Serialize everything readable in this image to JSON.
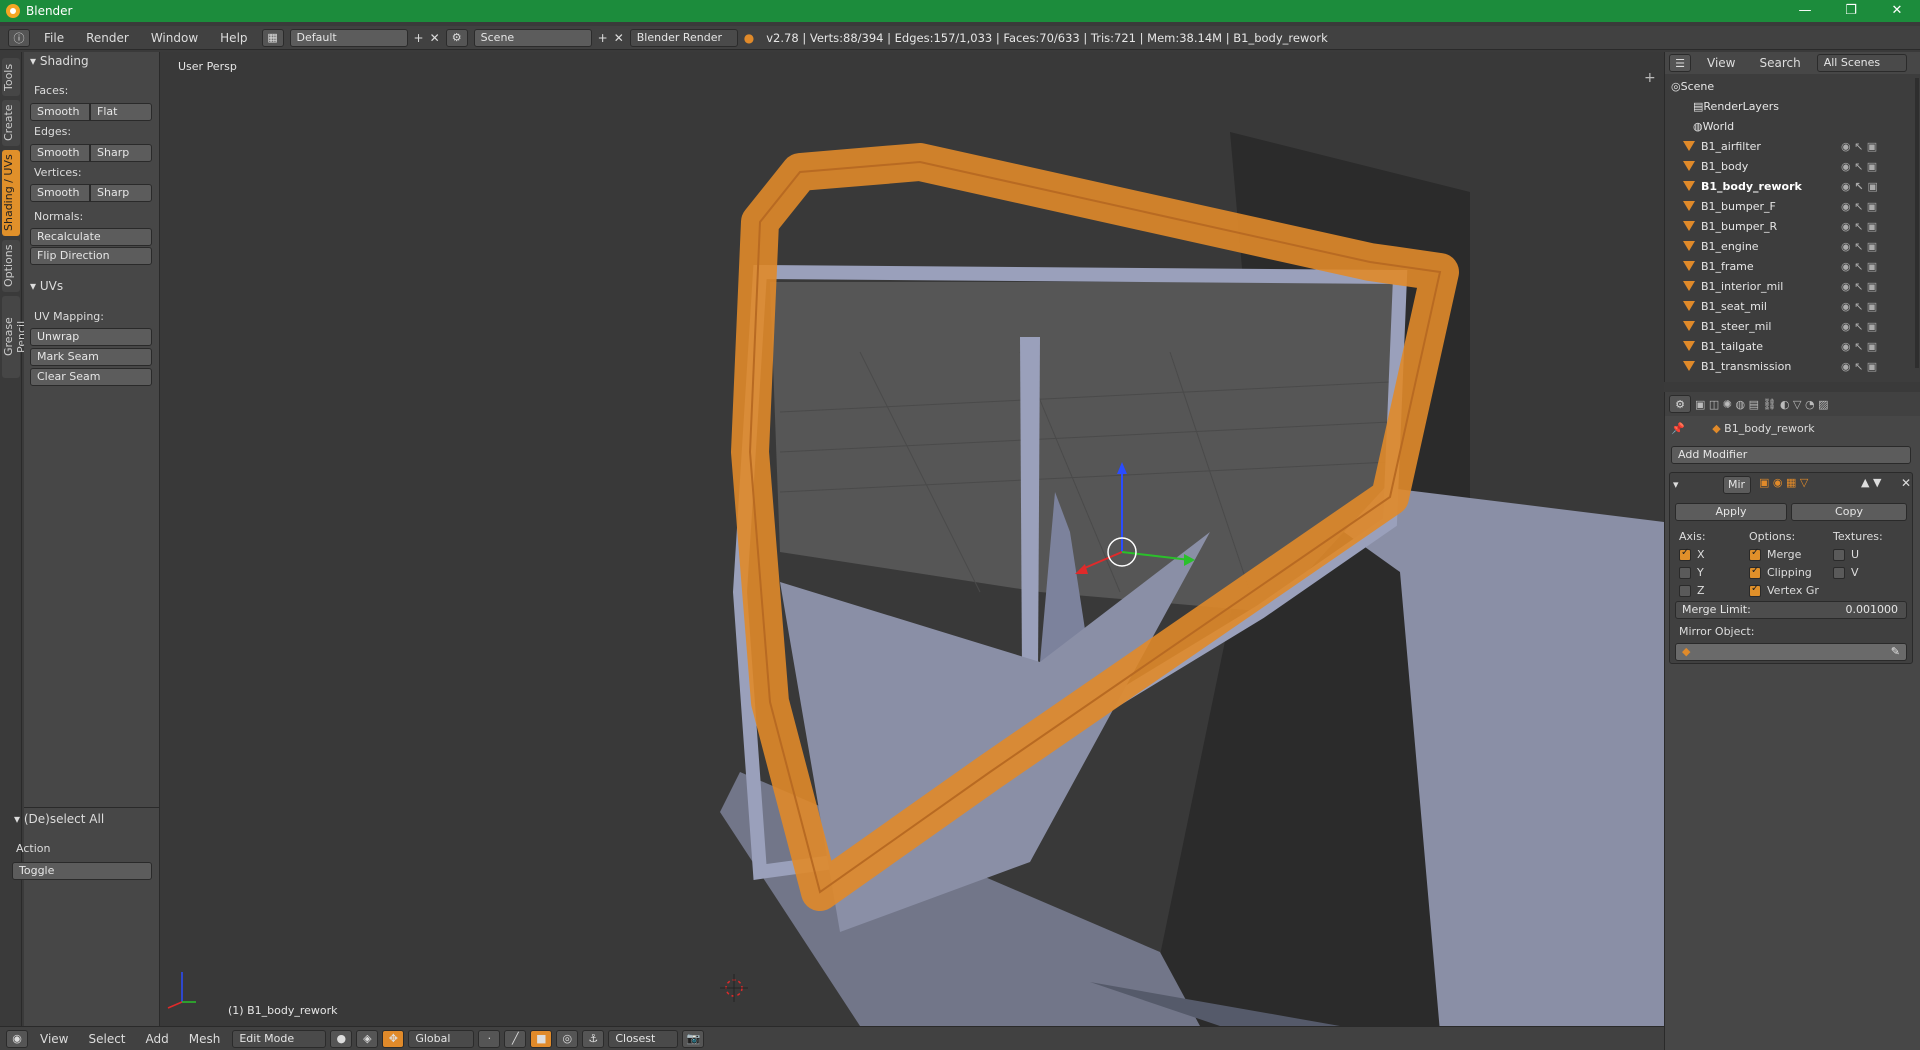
{
  "window": {
    "title": "Blender"
  },
  "menu": {
    "items": [
      "File",
      "Render",
      "Window",
      "Help"
    ],
    "layout": "Default",
    "scene": "Scene",
    "engine": "Blender Render",
    "stats": "v2.78 | Verts:88/394 | Edges:157/1,033 | Faces:70/633 | Tris:721 | Mem:38.14M | B1_body_rework"
  },
  "tool_tabs": [
    "Tools",
    "Create",
    "Shading / UVs",
    "Options",
    "Grease Pencil"
  ],
  "shading": {
    "header": "Shading",
    "faces_label": "Faces:",
    "edges_label": "Edges:",
    "vertices_label": "Vertices:",
    "normals_label": "Normals:",
    "smooth": "Smooth",
    "flat": "Flat",
    "sharp": "Sharp",
    "recalculate": "Recalculate",
    "flip": "Flip Direction"
  },
  "uvs": {
    "header": "UVs",
    "mapping_label": "UV Mapping:",
    "unwrap": "Unwrap",
    "mark_seam": "Mark Seam",
    "clear_seam": "Clear Seam"
  },
  "operator": {
    "header": "(De)select All",
    "action_label": "Action",
    "action_value": "Toggle"
  },
  "viewport": {
    "view_label": "User Persp",
    "object_label": "(1) B1_body_rework"
  },
  "bottom": {
    "items": [
      "View",
      "Select",
      "Add",
      "Mesh"
    ],
    "mode": "Edit Mode",
    "orientation": "Global",
    "snap": "Closest"
  },
  "outliner": {
    "view": "View",
    "search": "Search",
    "filter": "All Scenes",
    "rows": [
      "Scene",
      "RenderLayers",
      "World",
      "B1_airfilter",
      "B1_body",
      "B1_body_rework",
      "B1_bumper_F",
      "B1_bumper_R",
      "B1_engine",
      "B1_frame",
      "B1_interior_mil",
      "B1_seat_mil",
      "B1_steer_mil",
      "B1_tailgate",
      "B1_transmission"
    ]
  },
  "properties": {
    "object_name": "B1_body_rework",
    "add_modifier": "Add Modifier",
    "modifier_name": "Mir",
    "apply": "Apply",
    "copy": "Copy",
    "axis_label": "Axis:",
    "options_label": "Options:",
    "textures_label": "Textures:",
    "axis": [
      "X",
      "Y",
      "Z"
    ],
    "options": [
      "Merge",
      "Clipping",
      "Vertex Gr"
    ],
    "textures": [
      "U",
      "V"
    ],
    "merge_limit_label": "Merge Limit:",
    "merge_limit_value": "0.001000",
    "mirror_object_label": "Mirror Object:"
  }
}
